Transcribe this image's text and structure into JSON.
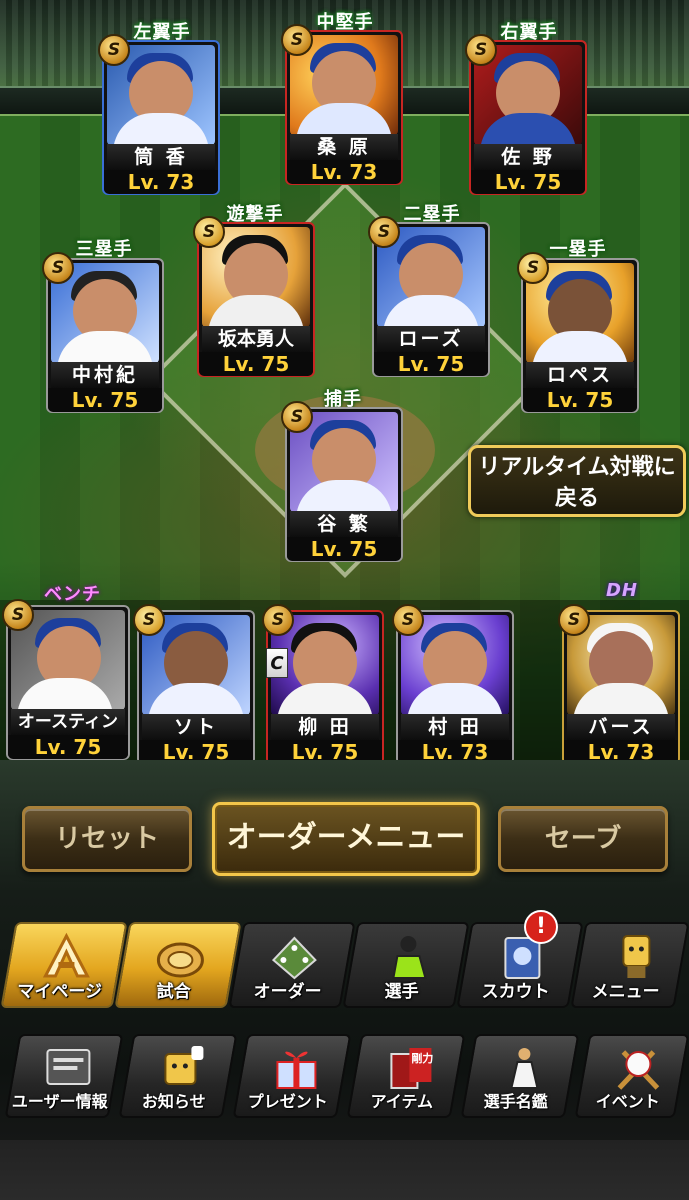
{
  "positions": {
    "lf": "左翼手",
    "cf": "中堅手",
    "rf": "右翼手",
    "ss": "遊撃手",
    "b3": "三塁手",
    "b2": "二塁手",
    "b1": "一塁手",
    "c": "捕手",
    "bench": "ベンチ",
    "dh": "DH"
  },
  "players": {
    "lf": {
      "name": "筒 香",
      "level": "Lv. 73",
      "badge": "S"
    },
    "cf": {
      "name": "桑 原",
      "level": "Lv. 73",
      "badge": "S"
    },
    "rf": {
      "name": "佐 野",
      "level": "Lv. 75",
      "badge": "S"
    },
    "ss": {
      "name": "坂本勇人",
      "level": "Lv. 75",
      "badge": "S"
    },
    "b3": {
      "name": "中村紀",
      "level": "Lv. 75",
      "badge": "S"
    },
    "b2": {
      "name": "ローズ",
      "level": "Lv. 75",
      "badge": "S"
    },
    "b1": {
      "name": "ロペス",
      "level": "Lv. 75",
      "badge": "S"
    },
    "c": {
      "name": "谷 繁",
      "level": "Lv. 75",
      "badge": "S"
    }
  },
  "bench": [
    {
      "name": "オースティン",
      "level": "Lv. 75",
      "badge": "S"
    },
    {
      "name": "ソト",
      "level": "Lv. 75",
      "badge": "S"
    },
    {
      "name": "柳 田",
      "level": "Lv. 75",
      "badge": "S",
      "extra": "C"
    },
    {
      "name": "村 田",
      "level": "Lv. 73",
      "badge": "S"
    },
    {
      "name": "バース",
      "level": "Lv. 73",
      "badge": "S"
    }
  ],
  "back_button": {
    "line1": "リアルタイム対戦に",
    "line2": "戻る"
  },
  "actions": {
    "reset": "リセット",
    "order_menu": "オーダーメニュー",
    "save": "セーブ"
  },
  "nav_main": [
    {
      "label": "マイページ",
      "icon": "home-a-icon"
    },
    {
      "label": "試合",
      "icon": "stadium-icon"
    },
    {
      "label": "オーダー",
      "icon": "field-icon"
    },
    {
      "label": "選手",
      "icon": "player-icon"
    },
    {
      "label": "スカウト",
      "icon": "scout-icon"
    },
    {
      "label": "メニュー",
      "icon": "menu-mascot-icon"
    }
  ],
  "nav_sub": [
    {
      "label": "ユーザー情報",
      "icon": "user-info-icon"
    },
    {
      "label": "お知らせ",
      "icon": "notice-icon"
    },
    {
      "label": "プレゼント",
      "icon": "gift-icon"
    },
    {
      "label": "アイテム",
      "icon": "item-book-icon"
    },
    {
      "label": "選手名鑑",
      "icon": "directory-icon"
    },
    {
      "label": "イベント",
      "icon": "event-ball-icon"
    }
  ],
  "notification": "!",
  "item_tag": "剛力",
  "colors": {
    "level": "#ffd23a",
    "gold": "#f3c64a",
    "nav_gold": "#e3a61f",
    "alert": "#d7231b"
  }
}
